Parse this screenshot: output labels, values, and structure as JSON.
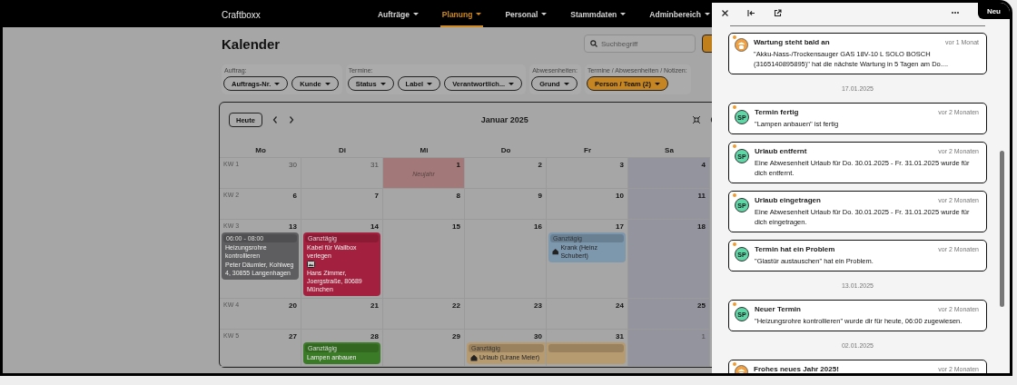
{
  "navbar": {
    "brand": "Craftboxx",
    "items": [
      {
        "label": "Aufträge",
        "selected": false
      },
      {
        "label": "Planung",
        "selected": true
      },
      {
        "label": "Personal",
        "selected": false
      },
      {
        "label": "Stammdaten",
        "selected": false
      },
      {
        "label": "Adminbereich",
        "selected": false
      }
    ]
  },
  "page": {
    "title": "Kalender",
    "search": {
      "placeholder": "Suchbegriff"
    }
  },
  "filters": [
    {
      "label": "Auftrag:",
      "buttons": [
        {
          "label": "Auftrags-Nr.",
          "active": false
        },
        {
          "label": "Kunde",
          "active": false
        }
      ]
    },
    {
      "label": "Termine:",
      "buttons": [
        {
          "label": "Status",
          "active": false
        },
        {
          "label": "Label",
          "active": false
        },
        {
          "label": "Verantwortlich...",
          "active": false
        }
      ]
    },
    {
      "label": "Abwesenheiten:",
      "buttons": [
        {
          "label": "Grund",
          "active": false
        }
      ]
    },
    {
      "label": "Termine / Abwesenheiten / Notizen:",
      "buttons": [
        {
          "label": "Person / Team (2)",
          "active": true
        }
      ]
    }
  ],
  "calendar": {
    "today_button": "Heute",
    "title": "Januar 2025",
    "columns": [
      {
        "label": "Mo",
        "weekend": false
      },
      {
        "label": "Di",
        "weekend": false
      },
      {
        "label": "Mi",
        "weekend": false
      },
      {
        "label": "Do",
        "weekend": false
      },
      {
        "label": "Fr",
        "weekend": false
      },
      {
        "label": "Sa",
        "weekend": true
      }
    ],
    "weeks": [
      {
        "label": "KW 1",
        "days": [
          {
            "date": "30",
            "outside": true
          },
          {
            "date": "31",
            "outside": true
          },
          {
            "date": "1",
            "outside": false,
            "holiday": "Neujahr"
          },
          {
            "date": "2",
            "outside": false
          },
          {
            "date": "3",
            "outside": false
          },
          {
            "date": "4",
            "outside": false
          }
        ]
      },
      {
        "label": "KW 2",
        "days": [
          {
            "date": "6",
            "outside": false
          },
          {
            "date": "7",
            "outside": false
          },
          {
            "date": "8",
            "outside": false
          },
          {
            "date": "9",
            "outside": false
          },
          {
            "date": "10",
            "outside": false
          },
          {
            "date": "11",
            "outside": false
          }
        ]
      },
      {
        "label": "KW 3",
        "days": [
          {
            "date": "13",
            "outside": false,
            "events": [
              {
                "kind": "appointment",
                "color": "#5e5e60",
                "time": "06:00 - 08:00",
                "title": "Heizungsrohre kontrollieren",
                "address": "Peter Däumler, Kohlweg 4, 30855 Langenhagen"
              }
            ]
          },
          {
            "date": "14",
            "outside": false,
            "events": [
              {
                "kind": "appointment",
                "color": "#a4203f",
                "time": "Ganztägig",
                "title": "Kabel für Wallbox verlegen",
                "attachment": true,
                "address": "Hans Zimmer, Joergstraße, 80689 München"
              }
            ]
          },
          {
            "date": "15",
            "outside": false
          },
          {
            "date": "16",
            "outside": false
          },
          {
            "date": "17",
            "outside": false,
            "events": [
              {
                "kind": "absence",
                "color": "#7d97ad",
                "time": "Ganztägig",
                "title": "Krank (Heinz Schubert)"
              }
            ]
          },
          {
            "date": "18",
            "outside": false
          }
        ]
      },
      {
        "label": "KW 4",
        "days": [
          {
            "date": "20",
            "outside": false
          },
          {
            "date": "21",
            "outside": false
          },
          {
            "date": "22",
            "outside": false
          },
          {
            "date": "23",
            "outside": false
          },
          {
            "date": "24",
            "outside": false
          },
          {
            "date": "25",
            "outside": false
          }
        ]
      },
      {
        "label": "KW 5",
        "days": [
          {
            "date": "27",
            "outside": false
          },
          {
            "date": "28",
            "outside": false,
            "events": [
              {
                "kind": "appointment",
                "color": "#3b7a26",
                "time": "Ganztägig",
                "title": "Lampen anbauen"
              }
            ]
          },
          {
            "date": "29",
            "outside": false
          },
          {
            "date": "30",
            "outside": false,
            "events": [
              {
                "kind": "absence",
                "color": "#b69a70",
                "time": "Ganztägig",
                "title": "Urlaub (Lirane Meier)",
                "continues_next_day": true
              }
            ]
          },
          {
            "date": "31",
            "outside": false
          },
          {
            "date": "1",
            "outside": true
          }
        ]
      }
    ]
  },
  "panel": {
    "new_button": "Neu",
    "items": [
      {
        "kind": "notification",
        "avatar": {
          "kind": "logo"
        },
        "unread": true,
        "title": "Wartung steht bald an",
        "time": "vor 1 Monat",
        "body": "\"Akku-Nass-/Trockensauger GAS 18V-10 L SOLO BOSCH (3165140895895)\" hat die nächste Wartung in 5 Tagen am Do...."
      },
      {
        "kind": "separator",
        "text": "17.01.2025"
      },
      {
        "kind": "notification",
        "avatar": {
          "kind": "initials",
          "text": "SP"
        },
        "unread": true,
        "title": "Termin fertig",
        "time": "vor 2 Monaten",
        "body": "\"Lampen anbauen\" ist fertig"
      },
      {
        "kind": "notification",
        "avatar": {
          "kind": "initials",
          "text": "SP"
        },
        "unread": true,
        "title": "Urlaub entfernt",
        "time": "vor 2 Monaten",
        "body": "Eine Abwesenheit Urlaub für Do. 30.01.2025 - Fr. 31.01.2025 wurde für dich entfernt."
      },
      {
        "kind": "notification",
        "avatar": {
          "kind": "initials",
          "text": "SP"
        },
        "unread": true,
        "title": "Urlaub eingetragen",
        "time": "vor 2 Monaten",
        "body": "Eine Abwesenheit Urlaub für Do. 30.01.2025 - Fr. 31.01.2025 wurde für dich eingetragen."
      },
      {
        "kind": "notification",
        "avatar": {
          "kind": "initials",
          "text": "SP"
        },
        "unread": true,
        "title": "Termin hat ein Problem",
        "time": "vor 2 Monaten",
        "body": "\"Glastür austauschen\" hat ein Problem."
      },
      {
        "kind": "separator",
        "text": "13.01.2025"
      },
      {
        "kind": "notification",
        "avatar": {
          "kind": "initials",
          "text": "SP"
        },
        "unread": true,
        "title": "Neuer Termin",
        "time": "vor 2 Monaten",
        "body": "\"Heizungsrohre kontrollieren\" wurde dir für heute, 06:00 zugewiesen."
      },
      {
        "kind": "separator",
        "text": "02.01.2025"
      },
      {
        "kind": "notification",
        "avatar": {
          "kind": "logo"
        },
        "unread": true,
        "title": "Frohes neues Jahr 2025!",
        "time": "vor 2 Monaten"
      }
    ]
  }
}
